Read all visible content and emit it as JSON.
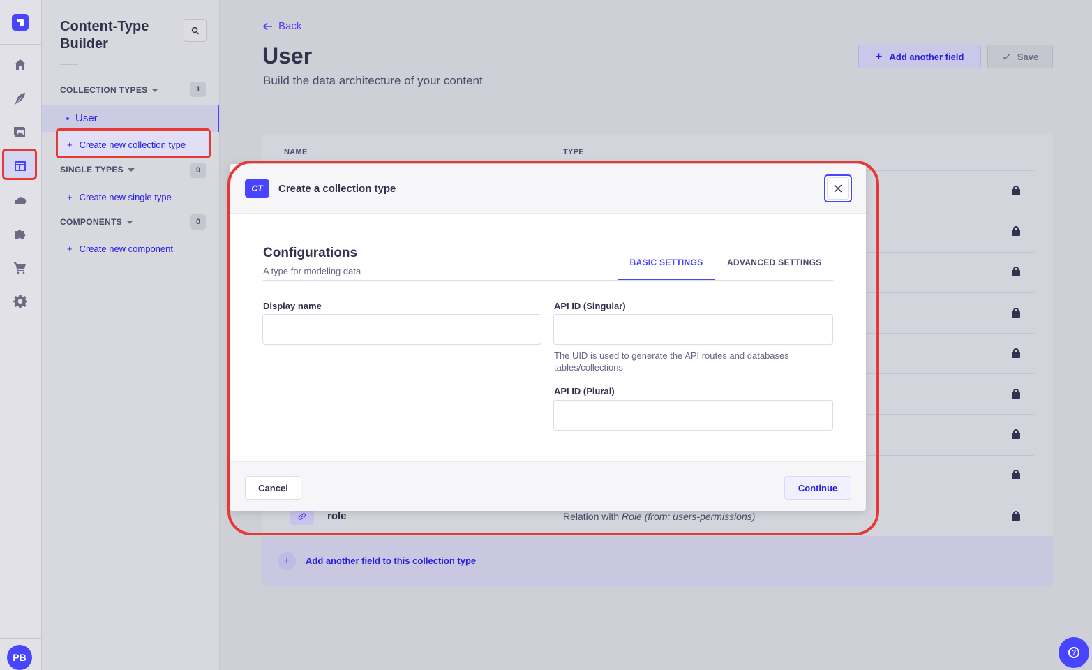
{
  "app": {
    "user_initials": "PB"
  },
  "rail": {
    "items": [
      "home-icon",
      "feather-icon",
      "media-icon",
      "content-type-builder-icon",
      "cloud-icon",
      "puzzle-icon",
      "cart-icon",
      "settings-icon"
    ]
  },
  "sidebar": {
    "title": "Content-Type Builder",
    "collection_types": {
      "label": "COLLECTION TYPES",
      "count": "1",
      "items": [
        "User"
      ],
      "create_label": "Create new collection type"
    },
    "single_types": {
      "label": "SINGLE TYPES",
      "count": "0",
      "create_label": "Create new single type"
    },
    "components": {
      "label": "COMPONENTS",
      "count": "0",
      "create_label": "Create new component"
    }
  },
  "header": {
    "back_label": "Back",
    "title": "User",
    "subtitle": "Build the data architecture of your content",
    "add_field_label": "Add another field",
    "save_label": "Save"
  },
  "table": {
    "col_name": "NAME",
    "col_type": "TYPE",
    "last_row": {
      "name": "role",
      "type_prefix": "Relation with ",
      "type_italic": "Role (from: users-permissions)"
    },
    "add_footer_label": "Add another field to this collection type"
  },
  "modal": {
    "badge": "CT",
    "title": "Create a collection type",
    "section_title": "Configurations",
    "section_subtitle": "A type for modeling data",
    "tabs": {
      "basic": "BASIC SETTINGS",
      "advanced": "ADVANCED SETTINGS"
    },
    "display_name_label": "Display name",
    "display_name_value": "",
    "api_singular_label": "API ID (Singular)",
    "api_singular_value": "",
    "api_hint": "The UID is used to generate the API routes and databases tables/collections",
    "api_plural_label": "API ID (Plural)",
    "api_plural_value": "",
    "cancel_label": "Cancel",
    "continue_label": "Continue"
  },
  "colors": {
    "primary": "#4945ff",
    "highlight": "#e53935"
  }
}
